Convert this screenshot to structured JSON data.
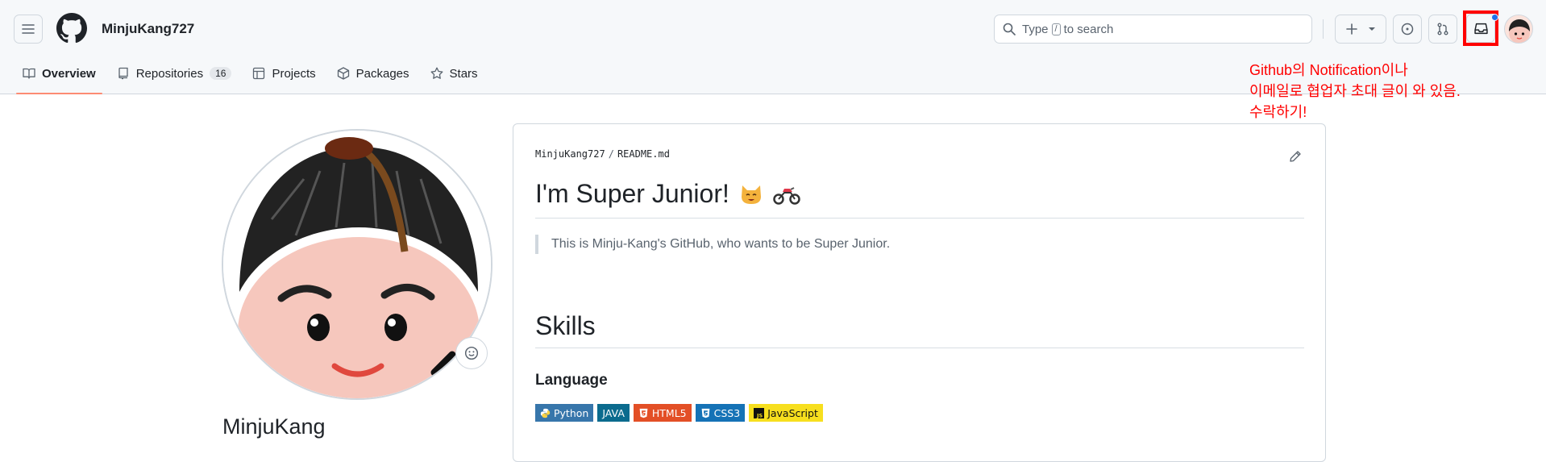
{
  "header": {
    "username": "MinjuKang727",
    "search": {
      "prefix": "Type",
      "key": "/",
      "suffix": "to search"
    },
    "icons": [
      "hamburger-icon",
      "github-logo-icon",
      "search-icon",
      "plus-icon",
      "triangle-down-icon",
      "issue-icon",
      "pull-request-icon",
      "inbox-icon",
      "avatar"
    ]
  },
  "tabs": [
    {
      "label": "Overview",
      "active": true,
      "icon": "book-icon"
    },
    {
      "label": "Repositories",
      "count": "16",
      "icon": "repo-icon"
    },
    {
      "label": "Projects",
      "icon": "table-icon"
    },
    {
      "label": "Packages",
      "icon": "package-icon"
    },
    {
      "label": "Stars",
      "icon": "star-icon"
    }
  ],
  "annotation": {
    "line1": "Github의 Notification이나",
    "line2": "이메일로 협업자 초대 글이 와 있음.",
    "line3": "수락하기!",
    "color": "#ff0000"
  },
  "profile": {
    "name": "MinjuKang"
  },
  "readme": {
    "owner": "MinjuKang727",
    "separator": "/",
    "file": "README.md",
    "title": "I'm Super Junior!",
    "quote": "This is Minju-Kang's GitHub, who wants to be Super Junior.",
    "skills_heading": "Skills",
    "language_heading": "Language",
    "badges": [
      {
        "label": "Python",
        "color": "#3776ab",
        "icon": "python-icon"
      },
      {
        "label": "JAVA",
        "color": "#0b6b8e",
        "icon": ""
      },
      {
        "label": "HTML5",
        "color": "#e34f26",
        "icon": "html5-icon"
      },
      {
        "label": "CSS3",
        "color": "#1572b6",
        "icon": "css3-icon"
      },
      {
        "label": "JavaScript",
        "color": "#f7df1e",
        "icon": "js-icon"
      }
    ]
  },
  "colors": {
    "accent_underline": "#fd8c73",
    "border": "#d0d7de",
    "notification_dot": "#1f6feb"
  }
}
